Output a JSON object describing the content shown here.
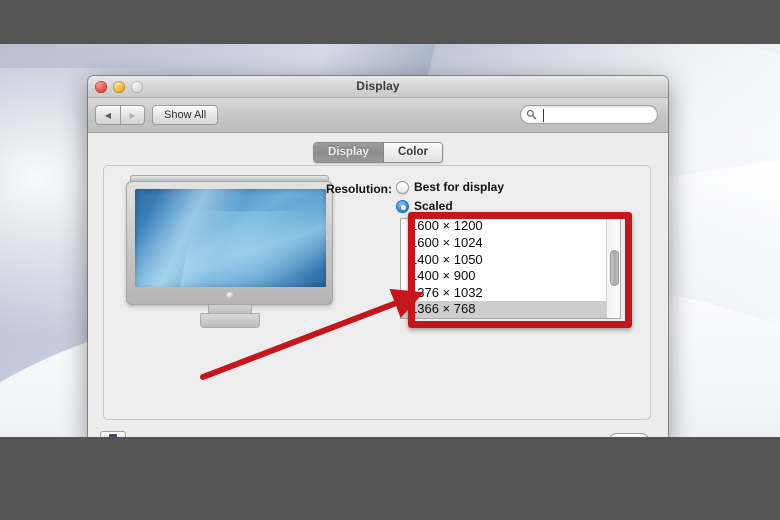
{
  "window": {
    "title": "Display",
    "traffic_lights": {
      "close": "close-button",
      "minimize": "minimize-button",
      "zoom": "zoom-button"
    },
    "toolbar": {
      "back_label": "◀",
      "forward_label": "▶",
      "show_all_label": "Show All",
      "search_value": "",
      "search_placeholder": ""
    },
    "tabs": [
      {
        "label": "Display",
        "active": true
      },
      {
        "label": "Color",
        "active": false
      }
    ],
    "resolution": {
      "label": "Resolution:",
      "options": [
        {
          "label": "Best for display",
          "selected": false
        },
        {
          "label": "Scaled",
          "selected": true
        }
      ],
      "list": [
        {
          "label": "1600 × 1200",
          "selected": false
        },
        {
          "label": "1600 × 1024",
          "selected": false
        },
        {
          "label": "1400 × 1050",
          "selected": false
        },
        {
          "label": "1400 × 900",
          "selected": false
        },
        {
          "label": "1376 × 1032",
          "selected": false
        },
        {
          "label": "1366 × 768",
          "selected": true
        }
      ]
    }
  },
  "annotation": {
    "highlight_color": "#c4161c",
    "arrow_color": "#c4161c"
  },
  "colors": {
    "letterbox": "#545454",
    "window_body": "#ececec",
    "selection": "#cdcdcd",
    "radio_blue": "#3f8fd6"
  }
}
